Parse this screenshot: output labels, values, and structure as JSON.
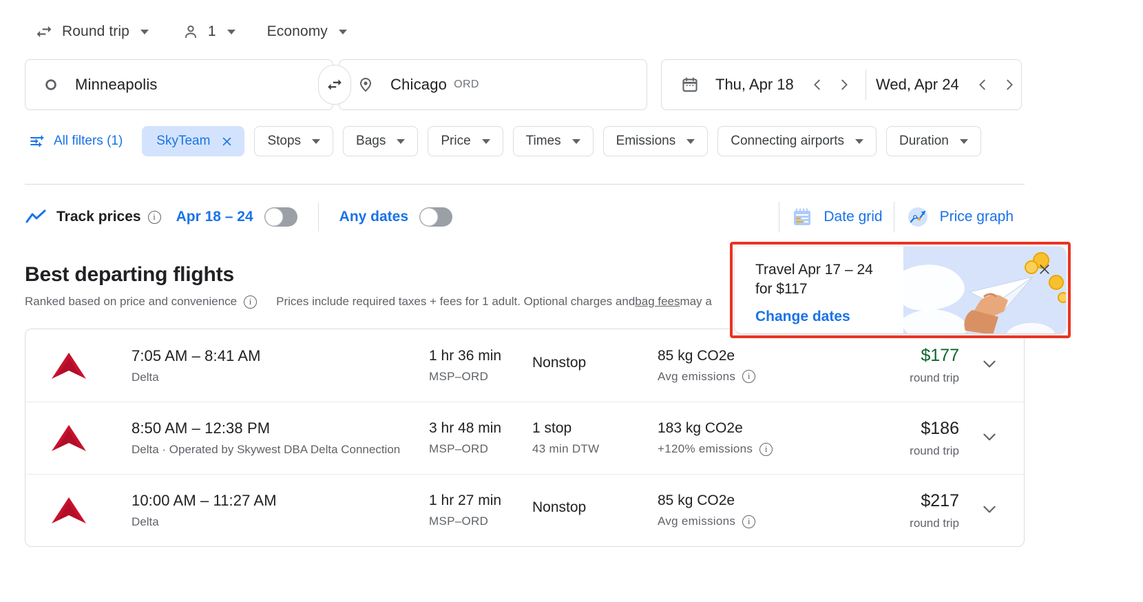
{
  "top_options": {
    "trip_type": {
      "icon": "swap-trip-icon",
      "label": "Round trip"
    },
    "passengers": {
      "icon": "person-icon",
      "label": "1"
    },
    "cabin": {
      "label": "Economy"
    }
  },
  "search": {
    "origin": {
      "icon": "circle-origin-icon",
      "value": "Minneapolis"
    },
    "destination": {
      "icon": "location-pin-icon",
      "value": "Chicago",
      "code": "ORD"
    },
    "swap_icon": "swap-places-icon",
    "calendar_icon": "calendar-icon",
    "depart_date": "Thu, Apr 18",
    "return_date": "Wed, Apr 24",
    "prev_icon": "chevron-left-icon",
    "next_icon": "chevron-right-icon"
  },
  "filters": {
    "all_filters": {
      "icon": "tune-filters-icon",
      "label": "All filters (1)"
    },
    "active_chip": {
      "label": "SkyTeam",
      "close_icon": "close-icon"
    },
    "chips": [
      {
        "label": "Stops"
      },
      {
        "label": "Bags"
      },
      {
        "label": "Price"
      },
      {
        "label": "Times"
      },
      {
        "label": "Emissions"
      },
      {
        "label": "Connecting airports"
      },
      {
        "label": "Duration"
      }
    ]
  },
  "track": {
    "icon": "trending-line-icon",
    "label": "Track prices",
    "info_icon": "info-icon",
    "date_range_label": "Apr 18 – 24",
    "any_dates_label": "Any dates"
  },
  "views": {
    "date_grid": {
      "icon": "date-grid-icon",
      "label": "Date grid"
    },
    "price_graph": {
      "icon": "price-graph-icon",
      "label": "Price graph"
    }
  },
  "results": {
    "title": "Best departing flights",
    "ranked_note": "Ranked based on price and convenience",
    "ranked_info_icon": "info-icon",
    "prices_note_1": "Prices include required taxes + fees for 1 adult. Optional charges and ",
    "bag_fees_link": "bag fees",
    "prices_note_2": " may a"
  },
  "promo": {
    "line1": "Travel Apr 17 – 24",
    "line2": "for $117",
    "cta": "Change dates",
    "close_icon": "close-icon",
    "art": "paper-plane-coins-illustration"
  },
  "flights": [
    {
      "airline_logo": "delta-logo-icon",
      "times": "7:05 AM – 8:41 AM",
      "airline": "Delta",
      "duration": "1 hr 36 min",
      "route": "MSP–ORD",
      "stops": "Nonstop",
      "stop_detail": "",
      "emissions": "85 kg CO2e",
      "emissions_note": "Avg emissions",
      "emissions_info_icon": "info-icon",
      "price": "$177",
      "price_is_low": true,
      "price_note": "round trip",
      "expand_icon": "chevron-down-icon"
    },
    {
      "airline_logo": "delta-logo-icon",
      "times": "8:50 AM – 12:38 PM",
      "airline": "Delta · Operated by Skywest DBA Delta Connection",
      "duration": "3 hr 48 min",
      "route": "MSP–ORD",
      "stops": "1 stop",
      "stop_detail": "43 min DTW",
      "emissions": "183 kg CO2e",
      "emissions_note": "+120% emissions",
      "emissions_info_icon": "info-icon",
      "price": "$186",
      "price_is_low": false,
      "price_note": "round trip",
      "expand_icon": "chevron-down-icon"
    },
    {
      "airline_logo": "delta-logo-icon",
      "times": "10:00 AM – 11:27 AM",
      "airline": "Delta",
      "duration": "1 hr 27 min",
      "route": "MSP–ORD",
      "stops": "Nonstop",
      "stop_detail": "",
      "emissions": "85 kg CO2e",
      "emissions_note": "Avg emissions",
      "emissions_info_icon": "info-icon",
      "price": "$217",
      "price_is_low": false,
      "price_note": "round trip",
      "expand_icon": "chevron-down-icon"
    }
  ],
  "colors": {
    "accent_blue": "#1a73e8",
    "chip_active_bg": "#d3e3fd",
    "low_price_green": "#0d652d",
    "highlight_red": "#ea3323",
    "delta_red": "#c8102e"
  }
}
